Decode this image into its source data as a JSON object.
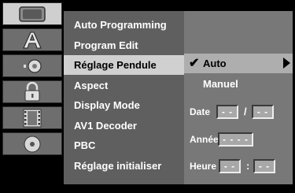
{
  "icons": [
    "tv-icon",
    "language-icon",
    "audio-icon",
    "lock-icon",
    "film-icon",
    "disc-icon"
  ],
  "menu": {
    "items": [
      "Auto Programming",
      "Program Edit",
      "Réglage Pendule",
      "Aspect",
      "Display Mode",
      "AV1 Decoder",
      "PBC",
      "Réglage initialiser"
    ],
    "selected": "Réglage Pendule"
  },
  "clock": {
    "options": [
      "Auto",
      "Manuel"
    ],
    "selected": "Auto",
    "date_label": "Date",
    "date_day": "- -",
    "date_sep": "/",
    "date_month": "- -",
    "year_label": "Année",
    "year_value": "- - - -",
    "time_label": "Heure",
    "time_hour": "- -",
    "time_sep": ":",
    "time_minute": "- -"
  },
  "colors": {
    "background": "#000000",
    "menu_bg": "#5f5f5f",
    "menu_selected_bg": "#d0d0d0",
    "panel_bg": "#787878",
    "option_selected_bg": "#aeaeae"
  }
}
